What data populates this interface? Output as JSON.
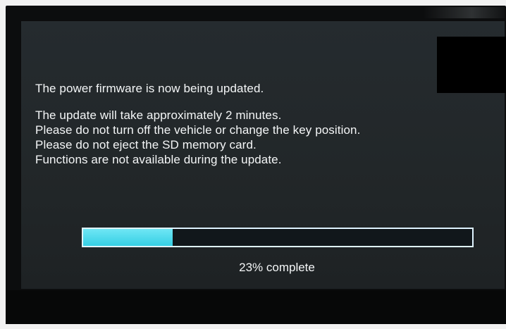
{
  "message": {
    "title": "The power firmware is now being updated.",
    "lines": [
      "The update will take approximately 2 minutes.",
      "Please do not turn off the vehicle or change the key position.",
      "Please do not eject the SD memory card.",
      "Functions are not available during the update."
    ]
  },
  "progress": {
    "value": 0.23,
    "label": "23% complete"
  },
  "colors": {
    "screen_background": "#232829",
    "text": "#f4f6f7",
    "progress_fill": "#35cfe4",
    "progress_border": "#dff3ff"
  }
}
